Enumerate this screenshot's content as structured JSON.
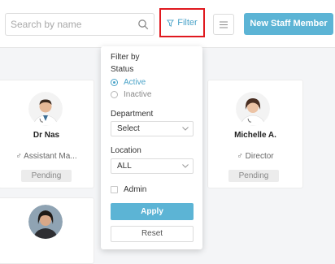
{
  "header": {
    "search_placeholder": "Search by name",
    "filter_label": "Filter",
    "new_staff_label": "New Staff Member"
  },
  "staff_cards": [
    {
      "name": "Dr Nas",
      "role": "Assistant Ma...",
      "status": "Pending"
    },
    {
      "name": "Michelle A.",
      "role": "Director",
      "status": "Pending"
    }
  ],
  "filter_panel": {
    "title": "Filter by",
    "status_label": "Status",
    "status_options": [
      "Active",
      "Inactive"
    ],
    "status_selected": "Active",
    "department_label": "Department",
    "department_value": "Select",
    "location_label": "Location",
    "location_value": "ALL",
    "admin_label": "Admin",
    "apply_label": "Apply",
    "reset_label": "Reset"
  },
  "colors": {
    "accent": "#5cb4d5",
    "highlight_border": "#e0191f",
    "badge_bg": "#ececec"
  }
}
